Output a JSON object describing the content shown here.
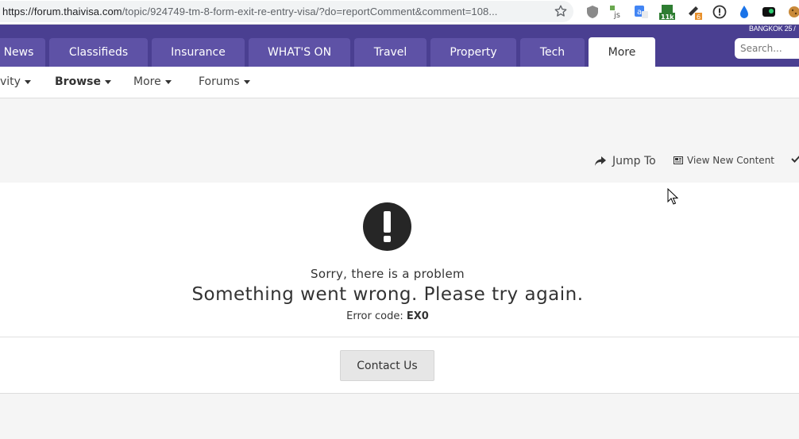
{
  "browser": {
    "url_host": "https://forum.thaivisa.com",
    "url_path": "/topic/924749-tm-8-form-exit-re-entry-visa/?do=reportComment&comment=108...",
    "extensions": [
      {
        "name": "shield-extension-icon"
      },
      {
        "name": "js-extension-icon",
        "label": "js"
      },
      {
        "name": "translate-extension-icon"
      },
      {
        "name": "counter-extension-icon",
        "label": "11k"
      },
      {
        "name": "rocket-extension-icon",
        "label": "6"
      },
      {
        "name": "info-extension-icon"
      },
      {
        "name": "droplet-extension-icon"
      },
      {
        "name": "dark-extension-icon"
      },
      {
        "name": "cookie-extension-icon"
      }
    ]
  },
  "header": {
    "datestamp": "BANGKOK 25 /",
    "tabs": [
      "News",
      "Classifieds",
      "Insurance",
      "WHAT'S ON",
      "Travel",
      "Property",
      "Tech",
      "More"
    ],
    "active_tab": "More",
    "search_placeholder": "Search..."
  },
  "subnav": {
    "items": [
      "vity",
      "Browse",
      "More",
      "Forums"
    ]
  },
  "actions": {
    "jump_to": "Jump To",
    "view_new_content": "View New Content"
  },
  "error": {
    "subtitle": "Sorry, there is a problem",
    "message": "Something went wrong. Please try again.",
    "code_label": "Error code:",
    "code_value": "EX0"
  },
  "contact_button": "Contact Us",
  "colors": {
    "nav_bg": "#4a3f91",
    "tab_bg": "#5e52a6",
    "page_bg": "#f5f5f5"
  }
}
